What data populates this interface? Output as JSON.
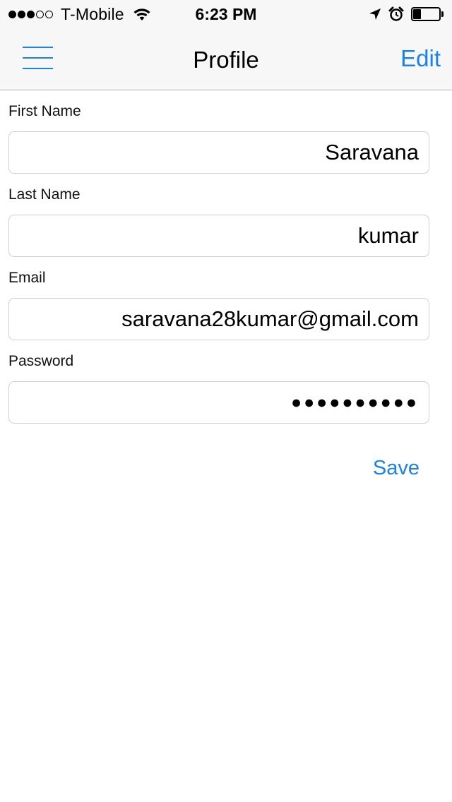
{
  "status_bar": {
    "carrier": "T-Mobile",
    "time": "6:23 PM",
    "signal": {
      "filled": 3,
      "total": 5
    },
    "battery_level": 0.3
  },
  "navbar": {
    "title": "Profile",
    "edit_label": "Edit",
    "menu_icon": "hamburger-menu-icon"
  },
  "form": {
    "first_name": {
      "label": "First Name",
      "value": "Saravana"
    },
    "last_name": {
      "label": "Last Name",
      "value": "kumar"
    },
    "email": {
      "label": "Email",
      "value": "saravana28kumar@gmail.com"
    },
    "password": {
      "label": "Password",
      "value": "●●●●●●●●●●"
    }
  },
  "save_label": "Save",
  "colors": {
    "accent": "#1a82e8",
    "bar_background": "#f7f7f7",
    "field_border": "#cfcfcf"
  }
}
